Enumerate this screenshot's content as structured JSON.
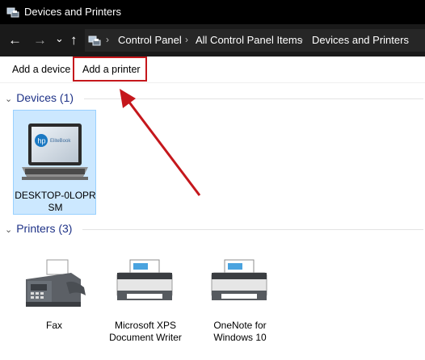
{
  "window": {
    "title": "Devices and Printers"
  },
  "nav": {
    "back": "←",
    "forward": "→",
    "dropdown": "⌄",
    "up": "↑"
  },
  "breadcrumb": {
    "items": [
      "Control Panel",
      "All Control Panel Items",
      "Devices and Printers"
    ],
    "separator": "›"
  },
  "toolbar": {
    "add_device": "Add a device",
    "add_printer": "Add a printer"
  },
  "devices": {
    "header": "Devices (1)",
    "items": [
      {
        "name_line1": "DESKTOP-0LOPR",
        "name_line2": "SM",
        "icon": "laptop-icon",
        "brand": "hp",
        "model": "EliteBook"
      }
    ]
  },
  "printers": {
    "header": "Printers (3)",
    "items": [
      {
        "name_line1": "Fax",
        "name_line2": "",
        "icon": "fax-icon"
      },
      {
        "name_line1": "Microsoft XPS",
        "name_line2": "Document Writer",
        "icon": "printer-icon"
      },
      {
        "name_line1": "OneNote for",
        "name_line2": "Windows 10",
        "icon": "printer-icon"
      }
    ]
  },
  "colors": {
    "accent_header": "#1e3287",
    "highlight_box": "#c5171c",
    "selection": "#cce8ff"
  }
}
